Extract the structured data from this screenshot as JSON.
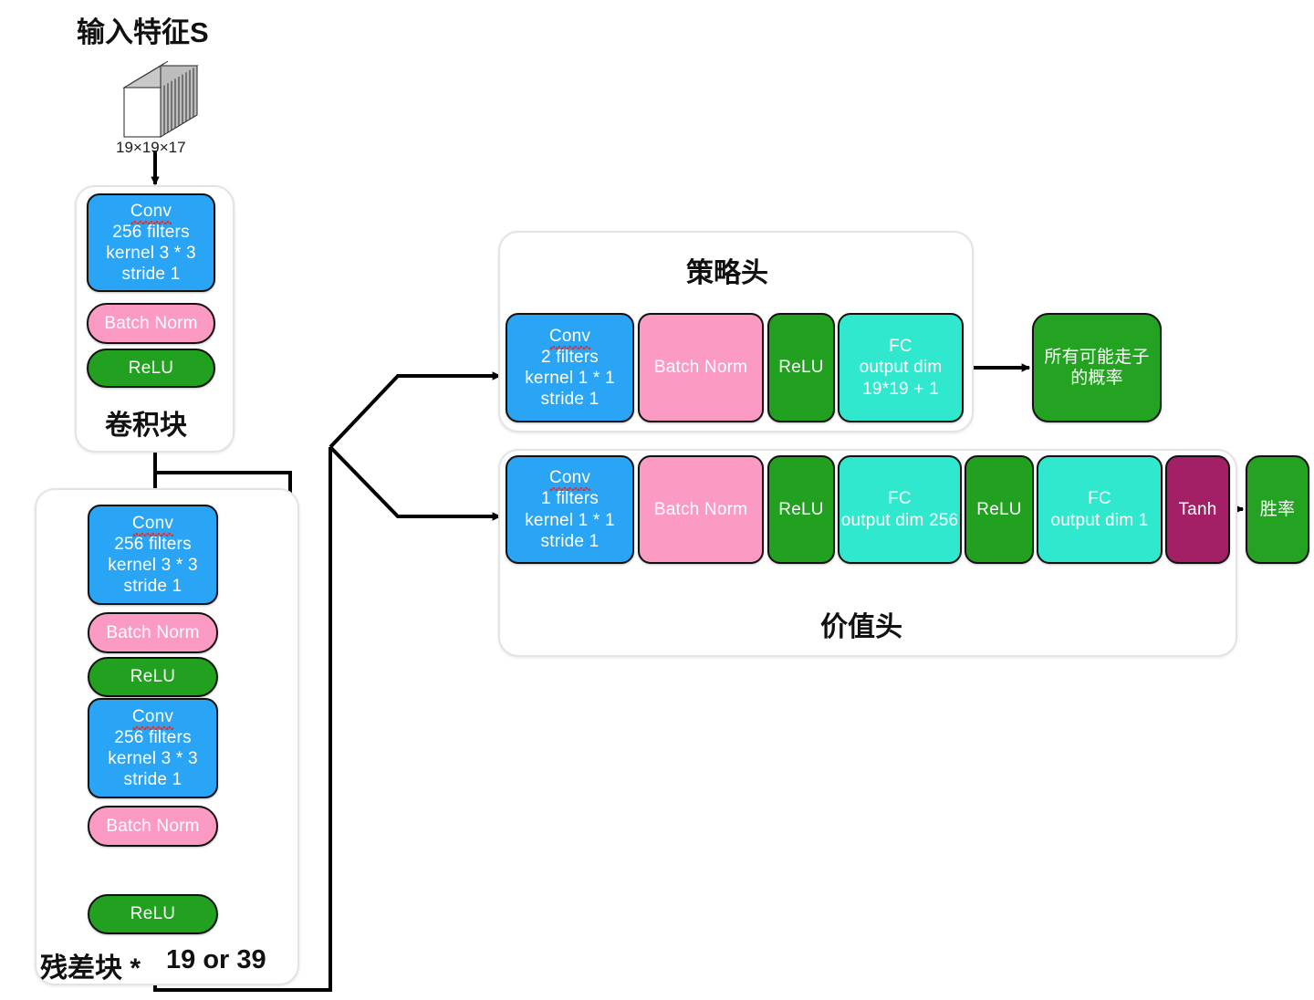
{
  "diagram": {
    "input": {
      "title": "输入特征S",
      "cube_label": "19×19×17",
      "cube_name": "input-feature-cube"
    },
    "conv_block": {
      "group_label": "卷积块",
      "layers": [
        {
          "type": "conv",
          "color": "#2AA4F4",
          "lines": [
            "Conv",
            "256 filters",
            "kernel 3 * 3",
            "stride 1"
          ]
        },
        {
          "type": "bn",
          "color": "#FB9BC4",
          "lines": [
            "Batch Norm"
          ]
        },
        {
          "type": "relu",
          "color": "#22A01F",
          "lines": [
            "ReLU"
          ]
        }
      ]
    },
    "residual_block": {
      "group_label": "残差块 *",
      "repeat_label": "19 or 39",
      "layers": [
        {
          "type": "conv",
          "color": "#2AA4F4",
          "lines": [
            "Conv",
            "256 filters",
            "kernel 3 * 3",
            "stride 1"
          ]
        },
        {
          "type": "bn",
          "color": "#FB9BC4",
          "lines": [
            "Batch Norm"
          ]
        },
        {
          "type": "relu",
          "color": "#22A01F",
          "lines": [
            "ReLU"
          ]
        },
        {
          "type": "conv",
          "color": "#2AA4F4",
          "lines": [
            "Conv",
            "256 filters",
            "kernel 3 * 3",
            "stride 1"
          ]
        },
        {
          "type": "bn",
          "color": "#FB9BC4",
          "lines": [
            "Batch Norm"
          ]
        },
        {
          "type": "relu",
          "color": "#22A01F",
          "lines": [
            "ReLU"
          ]
        }
      ]
    },
    "policy_head": {
      "group_label": "策略头",
      "layers": [
        {
          "type": "conv",
          "color": "#2AA4F4",
          "lines": [
            "Conv",
            "2 filters",
            "kernel 1 * 1",
            "stride 1"
          ]
        },
        {
          "type": "bn",
          "color": "#FB9BC4",
          "lines": [
            "Batch Norm"
          ]
        },
        {
          "type": "relu",
          "color": "#22A01F",
          "lines": [
            "ReLU"
          ]
        },
        {
          "type": "fc",
          "color": "#2FE8CE",
          "lines": [
            "FC",
            "output dim",
            "19*19 + 1"
          ]
        }
      ],
      "output": {
        "color": "#23A321",
        "lines": [
          "所有可能走子",
          "的概率"
        ]
      }
    },
    "value_head": {
      "group_label": "价值头",
      "layers": [
        {
          "type": "conv",
          "color": "#2AA4F4",
          "lines": [
            "Conv",
            "1 filters",
            "kernel 1 * 1",
            "stride 1"
          ]
        },
        {
          "type": "bn",
          "color": "#FB9BC4",
          "lines": [
            "Batch Norm"
          ]
        },
        {
          "type": "relu",
          "color": "#22A01F",
          "lines": [
            "ReLU"
          ]
        },
        {
          "type": "fc",
          "color": "#2FE8CE",
          "lines": [
            "FC",
            "output dim 256"
          ]
        },
        {
          "type": "relu",
          "color": "#22A01F",
          "lines": [
            "ReLU"
          ]
        },
        {
          "type": "fc",
          "color": "#2FE8CE",
          "lines": [
            "FC",
            "output dim 1"
          ]
        },
        {
          "type": "tanh",
          "color": "#A32066",
          "lines": [
            "Tanh"
          ]
        }
      ],
      "output": {
        "color": "#23A321",
        "lines": [
          "胜率"
        ]
      }
    },
    "colors": {
      "conv": "#2AA4F4",
      "batch_norm": "#FB9BC4",
      "relu": "#22A01F",
      "fc": "#2FE8CE",
      "tanh": "#A32066",
      "output": "#23A321",
      "wire": "#000000",
      "group_border": "#e3e3e3"
    }
  }
}
